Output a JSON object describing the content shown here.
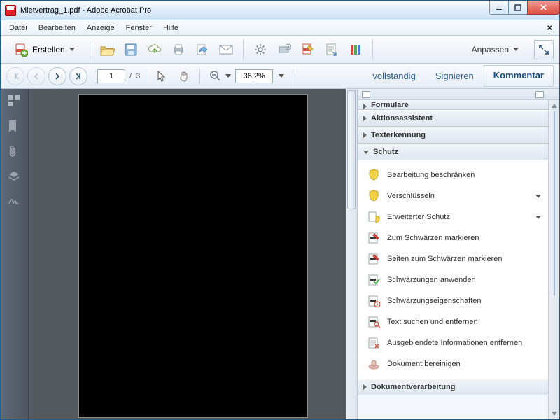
{
  "window": {
    "title": "Mietvertrag_1.pdf - Adobe Acrobat Pro"
  },
  "menu": {
    "items": [
      "Datei",
      "Bearbeiten",
      "Anzeige",
      "Fenster",
      "Hilfe"
    ]
  },
  "toolbar1": {
    "create": "Erstellen",
    "customize": "Anpassen"
  },
  "toolbar2": {
    "page_current": "1",
    "page_sep": "/",
    "page_total": "3",
    "zoom": "36,2%",
    "link_full": "vollständig",
    "link_sign": "Signieren",
    "link_comment": "Kommentar"
  },
  "panels": {
    "cut_header": "Formulare",
    "headers": [
      "Aktionsassistent",
      "Texterkennung",
      "Schutz"
    ],
    "footer_header": "Dokumentverarbeitung",
    "schutz_items": [
      {
        "label": "Bearbeitung beschränken",
        "icon": "shield",
        "dd": false
      },
      {
        "label": "Verschlüsseln",
        "icon": "shield",
        "dd": true
      },
      {
        "label": "Erweiterter Schutz",
        "icon": "advshield",
        "dd": true
      },
      {
        "label": "Zum Schwärzen markieren",
        "icon": "redact",
        "dd": false
      },
      {
        "label": "Seiten zum Schwärzen markieren",
        "icon": "redact",
        "dd": false
      },
      {
        "label": "Schwärzungen anwenden",
        "icon": "apply",
        "dd": false
      },
      {
        "label": "Schwärzungseigenschaften",
        "icon": "redprops",
        "dd": false
      },
      {
        "label": "Text suchen und entfernen",
        "icon": "search",
        "dd": false
      },
      {
        "label": "Ausgeblendete Informationen entfernen",
        "icon": "hidden",
        "dd": false
      },
      {
        "label": "Dokument bereinigen",
        "icon": "sanitize",
        "dd": false
      }
    ]
  }
}
